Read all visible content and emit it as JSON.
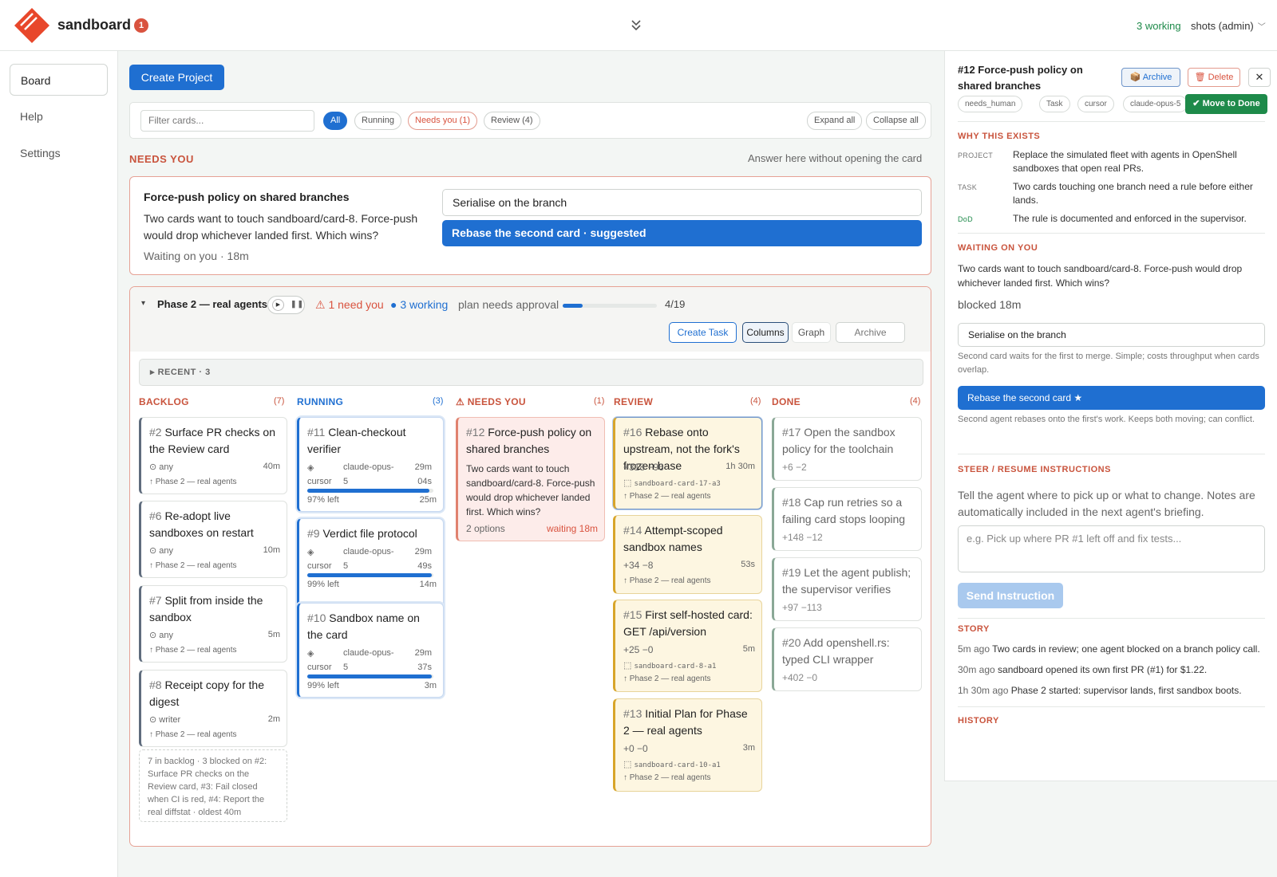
{
  "app": {
    "brand": "sandboard",
    "notif_count": "1",
    "working": "3 working",
    "user": "shots (admin)",
    "brand_color": "#e8472b",
    "accent": "#1f6fd1"
  },
  "nav": {
    "items": [
      {
        "label": "Board"
      },
      {
        "label": "Help"
      },
      {
        "label": "Settings"
      }
    ]
  },
  "main": {
    "create_project": "Create Project",
    "filter": {
      "placeholder": "Filter cards...",
      "chips": [
        "All",
        "Running",
        "Needs you (1)",
        "Review (4)"
      ],
      "expand_all": "Expand all",
      "collapse_all": "Collapse all"
    },
    "needs_you": {
      "label": "NEEDS YOU",
      "hint": "Answer here without opening the card",
      "title": "Force-push policy on shared branches",
      "desc": "Two cards want to touch sandboard/card-8. Force-push would drop whichever landed first. Which wins?",
      "waiting": "Waiting on you · 18m",
      "option_a": "Serialise on the branch",
      "option_b": "Rebase the second card · suggested"
    }
  },
  "project": {
    "caret": "▾",
    "title": "Phase 2 — real agents",
    "need_you": "⚠ 1 need you",
    "working": "● 3 working",
    "plan": "plan needs approval",
    "progress": 0.21,
    "progress_count": "4/19",
    "buttons": {
      "create_task": "Create Task",
      "columns": "Columns",
      "graph": "Graph",
      "archive": "Archive"
    },
    "recent": "▸ RECENT · 3",
    "columns": {
      "backlog": {
        "label": "BACKLOG",
        "count": "(7)",
        "color": "#c9543d"
      },
      "running": {
        "label": "RUNNING",
        "count": "(3)",
        "color": "#1f6fd1"
      },
      "needs": {
        "label": "⚠ NEEDS YOU",
        "count": "(1)",
        "color": "#c9543d"
      },
      "review": {
        "label": "REVIEW",
        "count": "(4)",
        "color": "#c9543d"
      },
      "done": {
        "label": "DONE",
        "count": "(4)",
        "color": "#c9543d"
      }
    },
    "backlog": [
      {
        "num": "#2",
        "title": " Surface PR checks on the Review card",
        "agent": "⊙ any",
        "age": "40m",
        "phase": "↑ Phase 2 — real agents"
      },
      {
        "num": "#6",
        "title": " Re-adopt live sandboxes on restart",
        "agent": "⊙ any",
        "age": "10m",
        "phase": "↑ Phase 2 — real agents"
      },
      {
        "num": "#7",
        "title": " Split from inside the sandbox",
        "agent": "⊙ any",
        "age": "5m",
        "phase": "↑ Phase 2 — real agents"
      },
      {
        "num": "#8",
        "title": " Receipt copy for the digest",
        "agent": "⊙ writer",
        "age": "2m",
        "phase": "↑ Phase 2 — real agents"
      }
    ],
    "backlog_note": "7 in backlog · 3 blocked on #2: Surface PR checks on the Review card, #3: Fail closed when CI is red, #4: Report the real diffstat · oldest 40m",
    "running": [
      {
        "num": "#11",
        "title": " Clean-checkout verifier",
        "icon": "◈",
        "model": "claude-opus-",
        "model2": "5",
        "tool": "cursor",
        "t1": "29m",
        "t2": "04s",
        "left": "97% left",
        "age": "25m",
        "progress": 0.97
      },
      {
        "num": "#9",
        "title": " Verdict file protocol",
        "icon": "◈",
        "model": "claude-opus-",
        "model2": "5",
        "tool": "cursor",
        "t1": "29m",
        "t2": "49s",
        "left": "99% left",
        "age": "14m",
        "progress": 0.99
      },
      {
        "num": "#10",
        "title": " Sandbox name on the card",
        "icon": "◈",
        "model": "claude-opus-",
        "model2": "5",
        "tool": "cursor",
        "t1": "29m",
        "t2": "37s",
        "left": "99% left",
        "age": "3m",
        "progress": 0.99
      }
    ],
    "needs_card": {
      "num": "#12",
      "title": " Force-push policy on shared branches",
      "desc": "Two cards want to touch sandboard/card-8. Force-push would drop whichever landed first. Which wins?",
      "options": "2 options",
      "waiting": "waiting 18m"
    },
    "review": [
      {
        "num": "#16",
        "title": " Rebase onto upstream, not the fork's frozen base",
        "diff": "+318 −96",
        "age": "1h 30m",
        "branch": "sandboard-card-17-a3",
        "phase": "↑ Phase 2 — real agents"
      },
      {
        "num": "#14",
        "title": " Attempt-scoped sandbox names",
        "diff": "+34 −8",
        "age": "53s",
        "branch": "",
        "phase": "↑ Phase 2 — real agents"
      },
      {
        "num": "#15",
        "title": " First self-hosted card: GET /api/version",
        "diff": "+25 −0",
        "age": "5m",
        "branch": "sandboard-card-8-a1",
        "phase": "↑ Phase 2 — real agents"
      },
      {
        "num": "#13",
        "title": " Initial Plan for Phase 2 — real agents",
        "diff": "+0 −0",
        "age": "3m",
        "branch": "sandboard-card-10-a1",
        "phase": "↑ Phase 2 — real agents"
      }
    ],
    "done": [
      {
        "num": "#17",
        "title": " Open the sandbox policy for the toolchain",
        "diff": "+6 −2"
      },
      {
        "num": "#18",
        "title": " Cap run retries so a failing card stops looping",
        "diff": "+148 −12"
      },
      {
        "num": "#19",
        "title": " Let the agent publish; the supervisor verifies",
        "diff": "+97 −113"
      },
      {
        "num": "#20",
        "title": " Add openshell.rs: typed CLI wrapper",
        "diff": "+402 −0"
      }
    ]
  },
  "detail": {
    "title": "#12 Force-push policy on shared branches",
    "archive": "📦 Archive",
    "delete": "🗑 Delete",
    "close": "✕",
    "move_done": "✔ Move to Done",
    "tags": [
      "needs_human",
      "Task",
      "cursor",
      "claude-opus-5"
    ],
    "why_h": "WHY THIS EXISTS",
    "project_k": "PROJECT",
    "project_v": "Replace the simulated fleet with agents in OpenShell sandboxes that open real PRs.",
    "task_k": "TASK",
    "task_v": "Two cards touching one branch need a rule before either lands.",
    "dod_k": "DoD",
    "dod_v": "The rule is documented and enforced in the supervisor.",
    "waiting_h": "WAITING ON YOU",
    "waiting_v": "Two cards want to touch sandboard/card-8. Force-push would drop whichever landed first. Which wins?",
    "blocked": "blocked 18m",
    "opt_a": "Serialise on the branch",
    "opt_a_desc": "Second card waits for the first to merge. Simple; costs throughput when cards overlap.",
    "opt_b": "Rebase the second card ★",
    "opt_b_desc": "Second agent rebases onto the first's work. Keeps both moving; can conflict.",
    "steer_h": "STEER / RESUME INSTRUCTIONS",
    "steer_desc": "Tell the agent where to pick up or what to change. Notes are automatically included in the next agent's briefing.",
    "steer_placeholder": "e.g. Pick up where PR #1 left off and fix tests...",
    "send": "Send Instruction",
    "story_h": "STORY",
    "story": [
      {
        "t": "5m ago",
        "text": "Two cards in review; one agent blocked on a branch policy call."
      },
      {
        "t": "30m ago",
        "text": "sandboard opened its own first PR (#1) for $1.22."
      },
      {
        "t": "1h 30m ago",
        "text": "Phase 2 started: supervisor lands, first sandbox boots."
      }
    ],
    "history_h": "HISTORY"
  }
}
